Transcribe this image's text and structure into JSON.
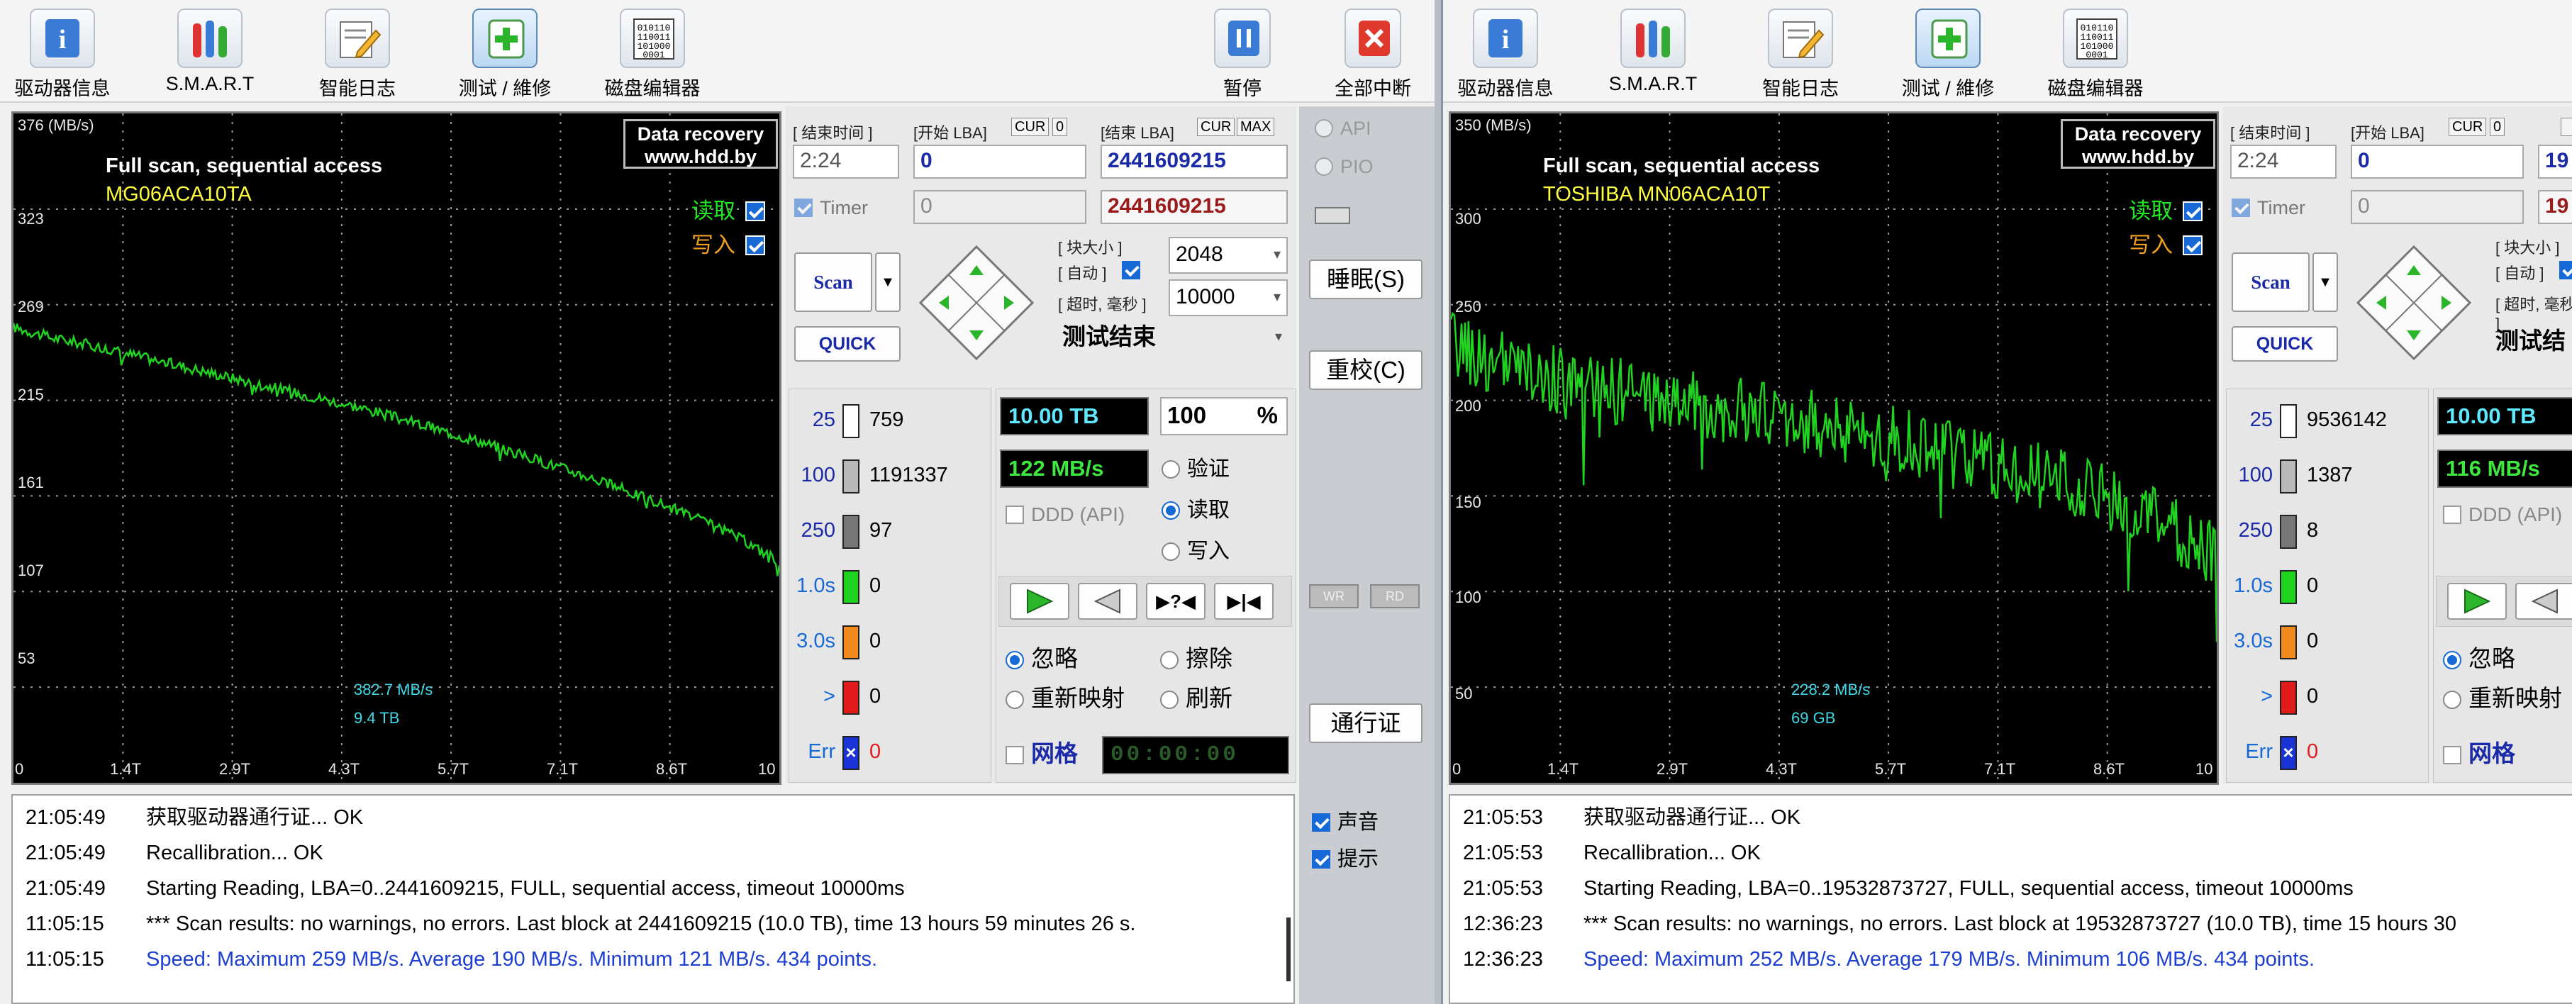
{
  "toolbar": {
    "items": [
      {
        "label": "驱动器信息",
        "icon": "info-icon"
      },
      {
        "label": "S.M.A.R.T",
        "icon": "smart-bars-icon"
      },
      {
        "label": "智能日志",
        "icon": "log-pencil-icon"
      },
      {
        "label": "测试 / 維修",
        "icon": "test-plus-icon"
      },
      {
        "label": "磁盘编辑器",
        "icon": "binary-editor-icon"
      }
    ],
    "pause_label": "暂停",
    "abort_label": "全部中断"
  },
  "left": {
    "graph": {
      "unit": "376 (MB/s)",
      "y_ticks": [
        "323",
        "269",
        "215",
        "161",
        "107",
        "53"
      ],
      "x_ticks": [
        "0",
        "1.4T",
        "2.9T",
        "4.3T",
        "5.7T",
        "7.1T",
        "8.6T",
        "10"
      ],
      "scan_mode": "Full scan, sequential access",
      "model": "MG06ACA10TA",
      "brand_line1": "Data recovery",
      "brand_line2": "www.hdd.by",
      "read_label": "读取",
      "write_label": "写入",
      "cur_speed": "382.7 MB/s",
      "cur_pos": "9.4 TB"
    },
    "controls": {
      "end_time_label": "[ 结束时间 ]",
      "start_lba_label": "[开始 LBA]",
      "end_lba_label": "[结束 LBA]",
      "cur_tag": "CUR",
      "cur_value": "0",
      "max_tag": "MAX",
      "time_value": "2:24",
      "start_lba": "0",
      "end_lba": "2441609215",
      "timer_label": "Timer",
      "timer_lba": "0",
      "timer_end_lba": "2441609215",
      "scan_button": "Scan",
      "quick_button": "QUICK",
      "block_size_label": "[ 块大小 ]",
      "auto_label": "[ 自动 ]",
      "timeout_label": "[ 超时, 毫秒 ]",
      "block_size": "2048",
      "timeout": "10000",
      "status": "测试结束",
      "api_label": "API",
      "pio_label": "PIO"
    },
    "stats": {
      "blocks": [
        {
          "label": "25",
          "value": "759",
          "color": "#ffffff"
        },
        {
          "label": "100",
          "value": "1191337",
          "color": "#b8b8b8"
        },
        {
          "label": "250",
          "value": "97",
          "color": "#777777"
        },
        {
          "label": "1.0s",
          "value": "0",
          "color": "#21d321"
        },
        {
          "label": "3.0s",
          "value": "0",
          "color": "#f08a1c"
        },
        {
          "label": ">",
          "value": "0",
          "color": "#e21a1a"
        },
        {
          "label": "Err",
          "value": "0",
          "color": "#1a33d6"
        }
      ],
      "capacity": "10.00 TB",
      "percent": "100",
      "percent_unit": "%",
      "speed": "122 MB/s",
      "ddd": "DDD (API)",
      "verify": "验证",
      "read": "读取",
      "write": "写入",
      "ignore": "忽略",
      "erase": "擦除",
      "remap": "重新映射",
      "refresh": "刷新",
      "grid": "网格",
      "timer_display": "00:00:00"
    },
    "side": {
      "sleep": "睡眠(S)",
      "recal": "重校(C)",
      "passport": "通行证",
      "wr": "WR",
      "rd": "RD",
      "sound": "声音",
      "hint": "提示"
    },
    "log": [
      {
        "time": "21:05:49",
        "msg": "获取驱动器通行证... OK",
        "color": "#000000"
      },
      {
        "time": "21:05:49",
        "msg": "Recallibration... OK",
        "color": "#000000"
      },
      {
        "time": "21:05:49",
        "msg": "Starting Reading, LBA=0..2441609215, FULL, sequential access, timeout 10000ms",
        "color": "#000000"
      },
      {
        "time": "11:05:15",
        "msg": "*** Scan results: no warnings, no errors. Last block at 2441609215 (10.0 TB), time 13 hours 59 minutes 26 s.",
        "color": "#000000"
      },
      {
        "time": "11:05:15",
        "msg": "Speed: Maximum 259 MB/s. Average 190 MB/s. Minimum 121 MB/s. 434 points.",
        "color": "#1d3fd0"
      }
    ]
  },
  "right": {
    "graph": {
      "unit": "350 (MB/s)",
      "y_ticks": [
        "300",
        "250",
        "200",
        "150",
        "100",
        "50"
      ],
      "x_ticks": [
        "0",
        "1.4T",
        "2.9T",
        "4.3T",
        "5.7T",
        "7.1T",
        "8.6T",
        "10"
      ],
      "scan_mode": "Full scan, sequential access",
      "model": "TOSHIBA MN06ACA10T",
      "brand_line1": "Data recovery",
      "brand_line2": "www.hdd.by",
      "read_label": "读取",
      "write_label": "写入",
      "cur_speed": "228.2 MB/s",
      "cur_pos": "69 GB"
    },
    "controls": {
      "end_time_label": "[ 结束时间 ]",
      "start_lba_label": "[开始 LBA]",
      "end_lba_label": "[结束 LBA]",
      "cur_tag": "CUR",
      "cur_value": "0",
      "time_value": "2:24",
      "start_lba": "0",
      "end_lba_partial": "19",
      "timer_label": "Timer",
      "timer_lba": "0",
      "timer_end_partial": "19",
      "scan_button": "Scan",
      "quick_button": "QUICK",
      "block_size_label": "[ 块大小 ]",
      "auto_label": "[ 自动 ]",
      "timeout_label": "[ 超时, 毫秒 ]",
      "status_partial": "测试结"
    },
    "stats": {
      "blocks": [
        {
          "label": "25",
          "value": "9536142",
          "color": "#ffffff"
        },
        {
          "label": "100",
          "value": "1387",
          "color": "#b8b8b8"
        },
        {
          "label": "250",
          "value": "8",
          "color": "#777777"
        },
        {
          "label": "1.0s",
          "value": "0",
          "color": "#21d321"
        },
        {
          "label": "3.0s",
          "value": "0",
          "color": "#f08a1c"
        },
        {
          "label": ">",
          "value": "0",
          "color": "#e21a1a"
        },
        {
          "label": "Err",
          "value": "0",
          "color": "#1a33d6"
        }
      ],
      "capacity": "10.00 TB",
      "speed": "116 MB/s",
      "ddd": "DDD (API)",
      "ignore": "忽略",
      "remap": "重新映射",
      "grid": "网格"
    },
    "log": [
      {
        "time": "21:05:53",
        "msg": "获取驱动器通行证... OK",
        "color": "#000000"
      },
      {
        "time": "21:05:53",
        "msg": "Recallibration... OK",
        "color": "#000000"
      },
      {
        "time": "21:05:53",
        "msg": "Starting Reading, LBA=0..19532873727, FULL, sequential access, timeout 10000ms",
        "color": "#000000"
      },
      {
        "time": "12:36:23",
        "msg": "*** Scan results: no warnings, no errors. Last block at 19532873727 (10.0 TB), time 15 hours 30",
        "color": "#000000"
      },
      {
        "time": "12:36:23",
        "msg": "Speed: Maximum 252 MB/s. Average 179 MB/s. Minimum 106 MB/s. 434 points.",
        "color": "#1d3fd0"
      }
    ]
  },
  "chart_data": [
    {
      "type": "line",
      "title": "Full scan, sequential access",
      "ylabel": "MB/s",
      "ylim": [
        0,
        376
      ],
      "xlim": [
        0,
        10
      ],
      "x_ticks": [
        "0",
        "1.4T",
        "2.9T",
        "4.3T",
        "5.7T",
        "7.1T",
        "8.6T",
        "10"
      ],
      "series": [
        {
          "name": "读取",
          "color": "#21d321",
          "x": [
            0,
            0.5,
            1,
            1.5,
            2,
            2.5,
            3,
            3.5,
            4,
            4.5,
            5,
            5.5,
            6,
            6.5,
            7,
            7.5,
            8,
            8.5,
            9,
            9.5,
            10
          ],
          "values": [
            256,
            250,
            246,
            241,
            236,
            231,
            226,
            221,
            216,
            211,
            205,
            199,
            193,
            186,
            179,
            172,
            164,
            156,
            147,
            137,
            124
          ],
          "noise": 3
        }
      ],
      "grid": true
    },
    {
      "type": "line",
      "title": "Full scan, sequential access",
      "ylabel": "MB/s",
      "ylim": [
        0,
        350
      ],
      "xlim": [
        0,
        10
      ],
      "x_ticks": [
        "0",
        "1.4T",
        "2.9T",
        "4.3T",
        "5.7T",
        "7.1T",
        "8.6T",
        "10"
      ],
      "series": [
        {
          "name": "读取",
          "color": "#21d321",
          "x": [
            0,
            0.5,
            1,
            1.5,
            2,
            2.5,
            3,
            3.5,
            4,
            4.5,
            5,
            5.5,
            6,
            6.5,
            7,
            7.5,
            8,
            8.5,
            9,
            9.5,
            10
          ],
          "values": [
            230,
            220,
            214,
            210,
            206,
            202,
            199,
            196,
            193,
            190,
            186,
            182,
            178,
            173,
            168,
            163,
            156,
            149,
            140,
            130,
            118
          ],
          "noise": 18
        }
      ],
      "grid": true
    }
  ]
}
